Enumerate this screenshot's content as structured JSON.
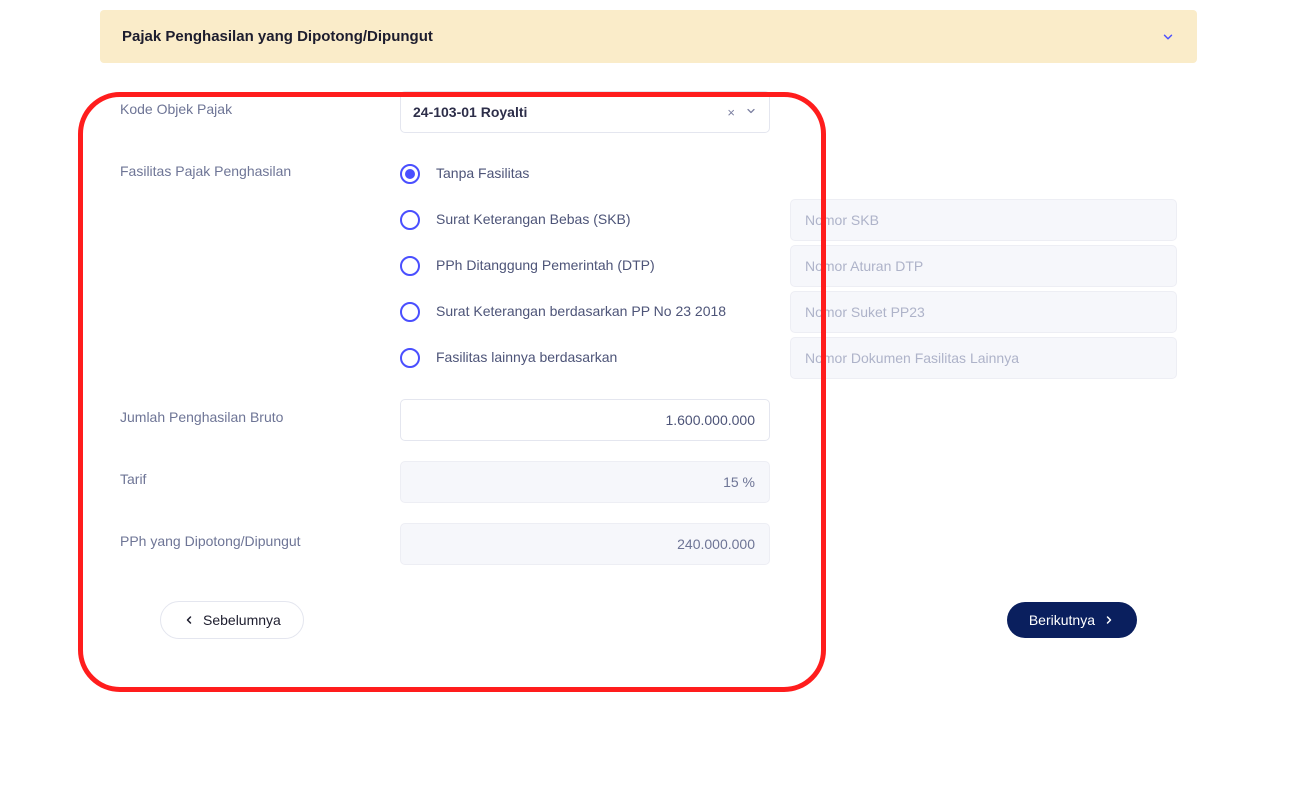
{
  "panel": {
    "title": "Pajak Penghasilan yang Dipotong/Dipungut"
  },
  "form": {
    "taxObject": {
      "label": "Kode Objek Pajak",
      "value": "24-103-01 Royalti"
    },
    "facility": {
      "label": "Fasilitas Pajak Penghasilan",
      "options": {
        "none": "Tanpa Fasilitas",
        "skb": "Surat Keterangan Bebas (SKB)",
        "dtp": "PPh Ditanggung Pemerintah (DTP)",
        "pp23": "Surat Keterangan berdasarkan PP No 23 2018",
        "other": "Fasilitas lainnya berdasarkan"
      },
      "placeholders": {
        "skb": "Nomor SKB",
        "dtp": "Nomor Aturan DTP",
        "pp23": "Nomor Suket PP23",
        "other": "Nomor Dokumen Fasilitas Lainnya"
      }
    },
    "gross": {
      "label": "Jumlah Penghasilan Bruto",
      "value": "1.600.000.000"
    },
    "rate": {
      "label": "Tarif",
      "value": "15 %"
    },
    "withheld": {
      "label": "PPh yang Dipotong/Dipungut",
      "value": "240.000.000"
    }
  },
  "nav": {
    "prev": "Sebelumnya",
    "next": "Berikutnya"
  }
}
